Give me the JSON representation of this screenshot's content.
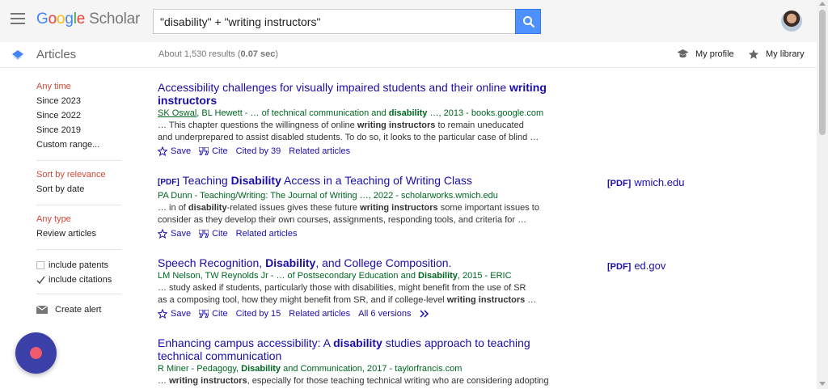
{
  "header": {
    "logo_letters": [
      "G",
      "o",
      "o",
      "g",
      "l",
      "e"
    ],
    "logo_scholar": "Scholar",
    "search_value": "\"disability\" + \"writing instructors\""
  },
  "subbar": {
    "section_label": "Articles",
    "results_prefix": "About 1,530 results (",
    "results_time": "0.07 sec",
    "results_suffix": ")",
    "my_profile": "My profile",
    "my_library": "My library"
  },
  "sidebar": {
    "time_filters": [
      "Any time",
      "Since 2023",
      "Since 2022",
      "Since 2019",
      "Custom range..."
    ],
    "sort_options": [
      "Sort by relevance",
      "Sort by date"
    ],
    "type_filters": [
      "Any type",
      "Review articles"
    ],
    "include_patents": "include patents",
    "include_citations": "include citations",
    "create_alert": "Create alert"
  },
  "results": [
    {
      "title_parts": [
        "Accessibility challenges for visually impaired students and their online ",
        "writing instructors"
      ],
      "authors_u1": "SK Oswal",
      "authors_rest_a": ", BL Hewett - … of technical communication and ",
      "authors_bold": "disability",
      "authors_rest_b": " …, 2013 - books.google.com",
      "snippet1_a": "… This chapter questions the willingness of online ",
      "snippet1_b": "writing instructors",
      "snippet1_c": " to remain uneducated",
      "snippet2": "and underprepared to assist disabled students. To do so, it looks to the particular case of blind …",
      "save": "Save",
      "cite": "Cite",
      "cited_by": "Cited by 39",
      "related": "Related articles"
    },
    {
      "pdf_tag": "[PDF]",
      "title_a": "Teaching ",
      "title_b": "Disability",
      "title_c": " Access in a Teaching of Writing Class",
      "authors": "PA Dunn - Teaching/Writing: The Journal of Writing …, 2022 - scholarworks.wmich.edu",
      "snippet1_a": "… in of ",
      "snippet1_b": "disability",
      "snippet1_c": "-related issues gives these future ",
      "snippet1_d": "writing instructors",
      "snippet1_e": " some important issues to",
      "snippet2": "consider as they develop their own courses, assignments, responding tools, and criteria for …",
      "save": "Save",
      "cite": "Cite",
      "related": "Related articles",
      "side_pdf": "[PDF]",
      "side_domain": "wmich.edu"
    },
    {
      "title_a": "Speech Recognition, ",
      "title_b": "Disability",
      "title_c": ", and College Composition.",
      "authors_a": "LM Nelson, TW Reynolds Jr - … of Postsecondary Education and ",
      "authors_bold": "Disability",
      "authors_b": ", 2015 - ERIC",
      "snippet1": "… study asked if students, particularly those with disabilities, might benefit from the use of SR",
      "snippet2_a": "as a composing tool, how they might benefit from SR, and if college-level ",
      "snippet2_b": "writing instructors",
      "snippet2_c": " …",
      "save": "Save",
      "cite": "Cite",
      "cited_by": "Cited by 15",
      "related": "Related articles",
      "versions": "All 6 versions",
      "side_pdf": "[PDF]",
      "side_domain": "ed.gov"
    },
    {
      "title_a": "Enhancing campus accessibility: A ",
      "title_b": "disability",
      "title_c": " studies approach to teaching",
      "title_d": "technical communication",
      "authors_a": "R Miner - Pedagogy, ",
      "authors_bold": "Disability",
      "authors_b": " and Communication, 2017 - taylorfrancis.com",
      "snippet1_a": "… ",
      "snippet1_b": "writing instructors",
      "snippet1_c": ", especially for those teaching technical writing who are considering adopting"
    }
  ],
  "icons": {
    "menu": "hamburger-icon",
    "search": "search-icon",
    "articles": "articles-icon",
    "profile": "graduation-cap-icon",
    "library": "star-icon",
    "save": "star-outline-icon",
    "cite": "quote-icon",
    "alert": "envelope-icon",
    "more": "double-chevron-icon"
  },
  "colors": {
    "link": "#1a0dab",
    "green": "#006621",
    "active": "#d14836",
    "search_btn": "#4d90fe",
    "fab": "#3b3fa8"
  }
}
